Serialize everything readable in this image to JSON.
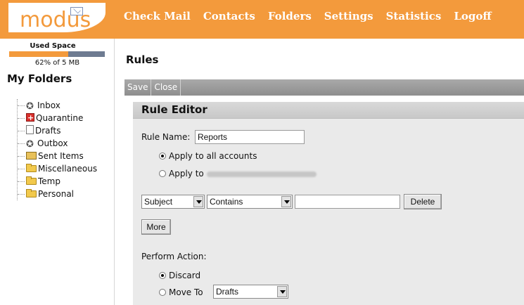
{
  "app": {
    "logo": "modus"
  },
  "nav": [
    "Check Mail",
    "Contacts",
    "Folders",
    "Settings",
    "Statistics",
    "Logoff"
  ],
  "sidebar": {
    "used_space_label": "Used Space",
    "usage_percent": 62,
    "usage_text": "62% of 5 MB",
    "my_folders": "My Folders",
    "folders": [
      {
        "label": "Inbox",
        "icon": "inbox-icon"
      },
      {
        "label": "Quarantine",
        "icon": "quarantine-icon"
      },
      {
        "label": "Drafts",
        "icon": "drafts-icon"
      },
      {
        "label": "Outbox",
        "icon": "outbox-icon"
      },
      {
        "label": "Sent Items",
        "icon": "sent-items-icon"
      },
      {
        "label": "Miscellaneous",
        "icon": "folder-icon"
      },
      {
        "label": "Temp",
        "icon": "folder-icon"
      },
      {
        "label": "Personal",
        "icon": "folder-icon"
      }
    ]
  },
  "main": {
    "title": "Rules",
    "toolbar": {
      "save": "Save",
      "close": "Close"
    },
    "editor": {
      "title": "Rule Editor",
      "rule_name_label": "Rule Name:",
      "rule_name_value": "Reports",
      "apply_all": "Apply to all accounts",
      "apply_to": "Apply to",
      "condition": {
        "field": "Subject",
        "operator": "Contains",
        "value": ""
      },
      "delete": "Delete",
      "more": "More",
      "perform_action": "Perform Action:",
      "discard": "Discard",
      "move_to": "Move To",
      "move_to_folder": "Drafts"
    }
  }
}
